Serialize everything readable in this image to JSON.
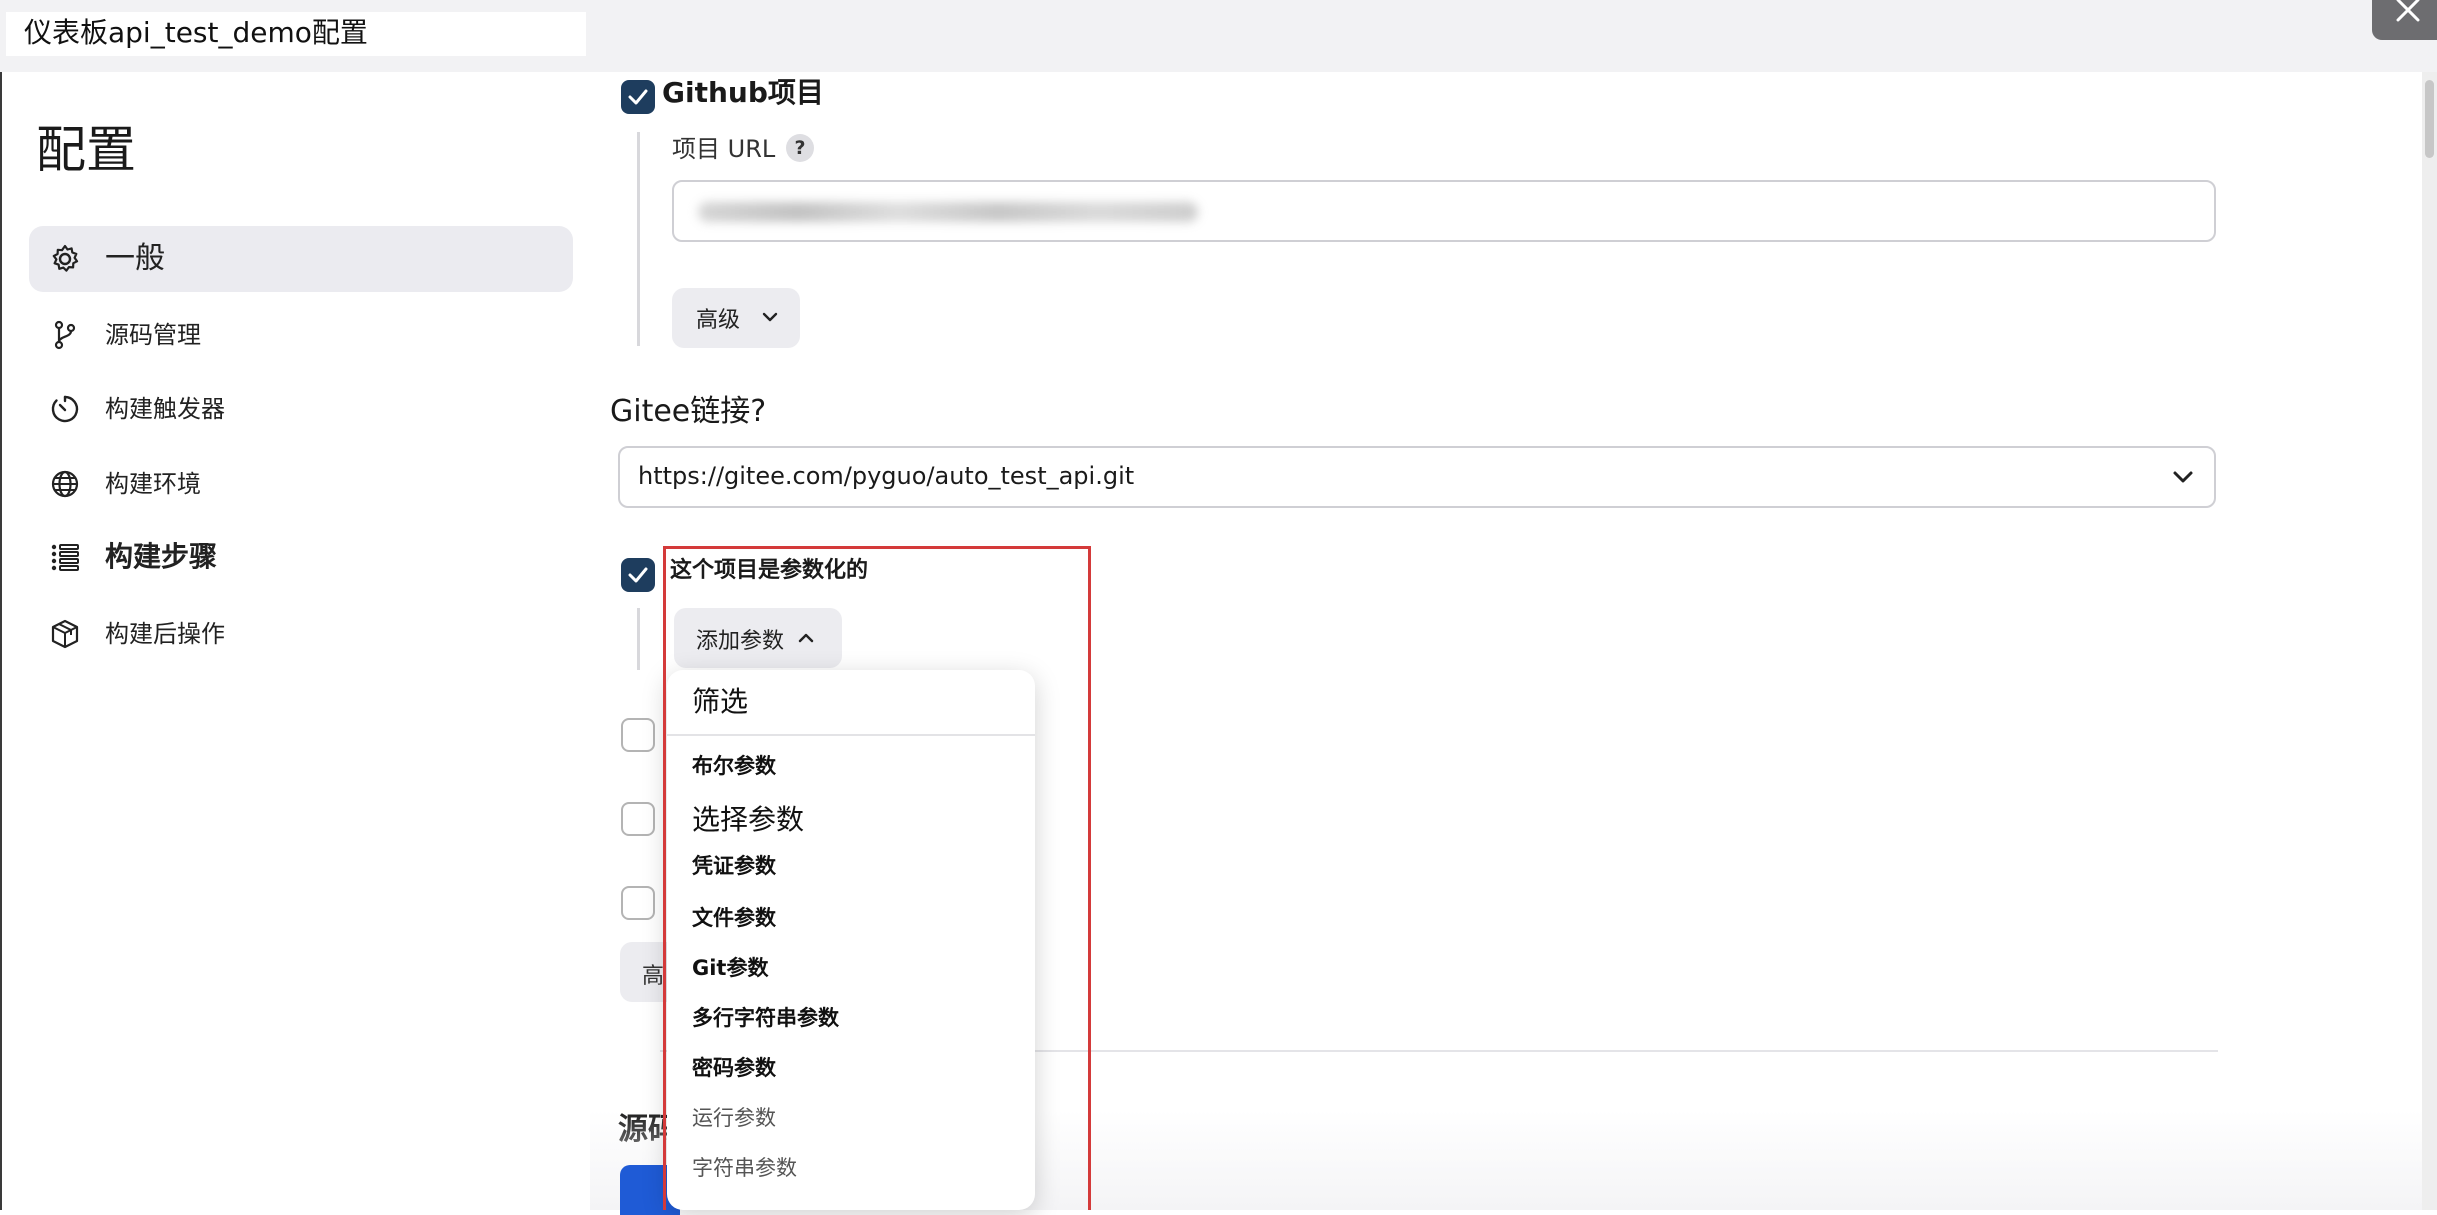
{
  "window": {
    "title": "仪表板api_test_demo配置"
  },
  "sidebar": {
    "title": "配置",
    "items": [
      {
        "label": "一般",
        "icon": "gear-icon",
        "active": true
      },
      {
        "label": "源码管理",
        "icon": "branch-icon"
      },
      {
        "label": "构建触发器",
        "icon": "timer-icon"
      },
      {
        "label": "构建环境",
        "icon": "globe-icon"
      },
      {
        "label": "构建步骤",
        "icon": "list-icon"
      },
      {
        "label": "构建后操作",
        "icon": "package-icon"
      }
    ]
  },
  "github": {
    "checkbox_label": "Github项目",
    "checked": true,
    "url_label": "项目 URL",
    "help": "?",
    "url_value": "",
    "advanced_label": "高级"
  },
  "gitee": {
    "label": "Gitee链接?",
    "selected": "https://gitee.com/pyguo/auto_test_api.git"
  },
  "parameterized": {
    "checkbox_label": "这个项目是参数化的",
    "checked": true,
    "add_param_label": "添加参数"
  },
  "dropdown": {
    "items": [
      "筛选",
      "布尔参数",
      "选择参数",
      "凭证参数",
      "文件参数",
      "Git参数",
      "多行字符串参数",
      "密码参数",
      "运行参数",
      "字符串参数"
    ]
  },
  "hidden": {
    "advanced_partial": "高",
    "section_partial": "源码"
  },
  "colors": {
    "checkbox_checked": "#1e3d5e",
    "highlight_box": "#d43a3a",
    "nav_active_bg": "#ebebf0"
  }
}
